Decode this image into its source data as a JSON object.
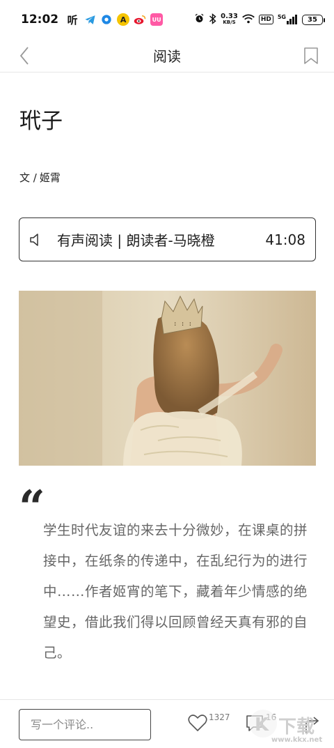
{
  "status_bar": {
    "time": "12:02",
    "app_icons": [
      "听",
      "telegram-icon",
      "circle-app-icon",
      "A",
      "weibo-icon",
      "UU"
    ],
    "net_speed_value": "0.33",
    "net_speed_unit": "KB/S",
    "hd_label": "HD",
    "signal_label": "5G",
    "battery": "35"
  },
  "header": {
    "title": "阅读"
  },
  "article": {
    "title": "玳子",
    "author_prefix": "文 /",
    "author_name": "姬霄",
    "audio": {
      "label": "有声阅读 | 朗读者-马晓橙",
      "duration": "41:08"
    },
    "quote_mark": "“",
    "summary": "学生时代友谊的来去十分微妙，在课桌的拼接中，在纸条的传递中，在乱纪行为的进行中……作者姬宵的笔下，藏着年少情感的绝望史，借此我们得以回顾曾经天真有邪的自己。"
  },
  "bottom_bar": {
    "comment_placeholder": "写一个评论..",
    "like_count": "1327",
    "comment_count": "16"
  },
  "watermark": {
    "text": "下载",
    "url": "www.kkx.net"
  },
  "colors": {
    "accent": "#222222",
    "muted_text": "#666666",
    "divider": "#e6e6e6"
  }
}
